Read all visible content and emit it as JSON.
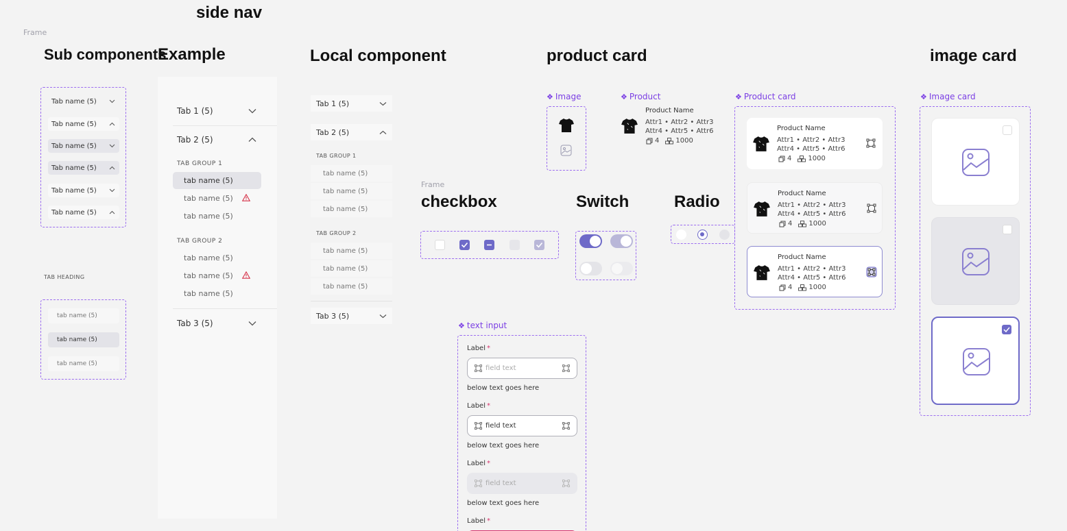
{
  "headings": {
    "side_nav": "side nav",
    "sub_components": "Sub components",
    "example": "Example",
    "local_component": "Local component",
    "product_card": "product card",
    "image_card": "image card",
    "checkbox": "checkbox",
    "switch": "Switch",
    "radio": "Radio"
  },
  "frame_label": "Frame",
  "sub_components": {
    "tabs": [
      {
        "label": "Tab name (5)",
        "state": "default",
        "chevron": "down"
      },
      {
        "label": "Tab name (5)",
        "state": "light",
        "chevron": "up"
      },
      {
        "label": "Tab name (5)",
        "state": "selected",
        "chevron": "down"
      },
      {
        "label": "Tab name (5)",
        "state": "selected",
        "chevron": "up"
      },
      {
        "label": "Tab name (5)",
        "state": "light",
        "chevron": "down"
      },
      {
        "label": "Tab name (5)",
        "state": "light",
        "chevron": "up"
      }
    ],
    "tab_heading": "TAB HEADING",
    "items": [
      {
        "label": "tab name (5)",
        "selected": false
      },
      {
        "label": "tab name (5)",
        "selected": true
      },
      {
        "label": "tab name (5)",
        "selected": false
      }
    ]
  },
  "example": {
    "tab1": "Tab 1 (5)",
    "tab2": "Tab 2 (5)",
    "group1": "TAB GROUP 1",
    "group1_items": [
      {
        "label": "tab name (5)",
        "selected": true,
        "warning": false
      },
      {
        "label": "tab name (5)",
        "selected": false,
        "warning": true
      },
      {
        "label": "tab name (5)",
        "selected": false,
        "warning": false
      }
    ],
    "group2": "TAB GROUP 2",
    "group2_items": [
      {
        "label": "tab name (5)",
        "selected": false,
        "warning": false
      },
      {
        "label": "tab name (5)",
        "selected": false,
        "warning": true
      },
      {
        "label": "tab name (5)",
        "selected": false,
        "warning": false
      }
    ],
    "tab3": "Tab 3 (5)"
  },
  "local": {
    "tab1": "Tab 1 (5)",
    "tab2": "Tab 2 (5)",
    "group1": "TAB GROUP 1",
    "group1_items": [
      "tab name (5)",
      "tab name (5)",
      "tab name (5)"
    ],
    "group2": "TAB GROUP 2",
    "group2_items": [
      "tab name (5)",
      "tab name (5)",
      "tab name (5)"
    ],
    "tab3": "Tab 3 (5)"
  },
  "product": {
    "image_label": "Image",
    "product_label": "Product",
    "card_label": "Product card",
    "name": "Product Name",
    "attrs_line1": "Attr1 • Attr2 • Attr3",
    "attrs_line2": "Attr4 • Attr5 • Attr6",
    "count": "4",
    "qty": "1000"
  },
  "image_card": {
    "label": "Image card",
    "cards": [
      {
        "state": "default",
        "checked": false
      },
      {
        "state": "hover",
        "checked": false
      },
      {
        "state": "selected",
        "checked": true
      }
    ]
  },
  "checkbox": {
    "states": [
      "unchecked",
      "checked",
      "indeterminate",
      "disabled",
      "disabled-checked"
    ]
  },
  "switch": {
    "states": [
      {
        "on": true,
        "disabled": false
      },
      {
        "on": true,
        "disabled": true
      },
      {
        "on": false,
        "disabled": false
      },
      {
        "on": false,
        "disabled": true
      }
    ]
  },
  "radio": {
    "states": [
      "unselected",
      "selected",
      "disabled"
    ]
  },
  "text_input": {
    "label": "text input",
    "fields": [
      {
        "label": "Label",
        "required": "*",
        "value": "field text",
        "helper": "below text goes here",
        "state": "placeholder"
      },
      {
        "label": "Label",
        "required": "*",
        "value": "field text",
        "helper": "below text goes here",
        "state": "filled"
      },
      {
        "label": "Label",
        "required": "*",
        "value": "field text",
        "helper": "below text goes here",
        "state": "disabled"
      },
      {
        "label": "Label",
        "required": "*",
        "state": "error"
      }
    ]
  },
  "colors": {
    "accent": "#7b3fe4",
    "primary": "#6e6ac8",
    "dashed": "#9b6cf0",
    "warning": "#d6334a"
  }
}
